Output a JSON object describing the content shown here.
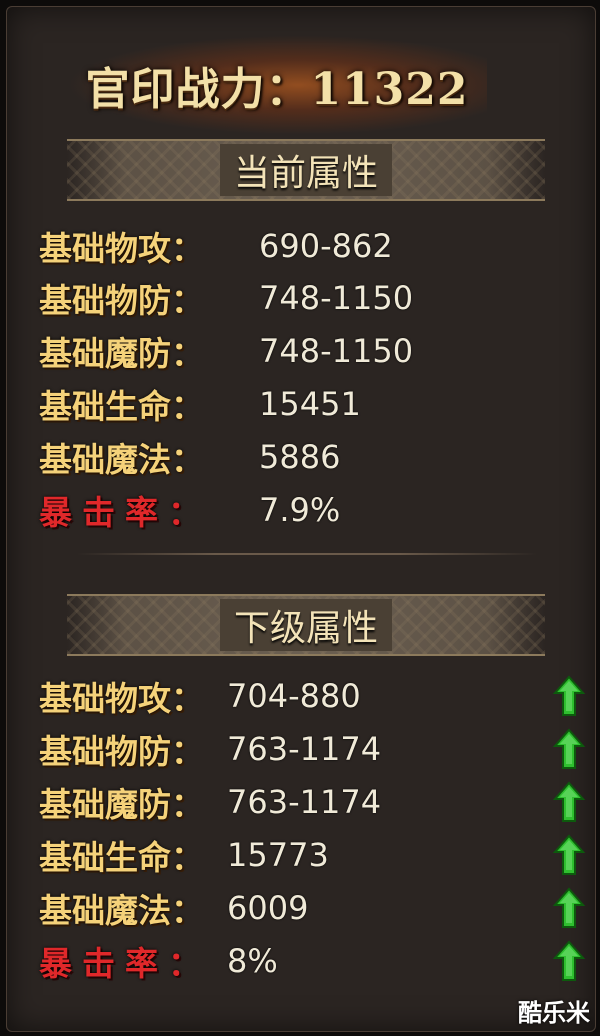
{
  "power": {
    "text": "官印战力：11322"
  },
  "current": {
    "title": "当前属性",
    "stats": [
      {
        "label": "基础物攻：",
        "value": "690-862"
      },
      {
        "label": "基础物防：",
        "value": "748-1150"
      },
      {
        "label": "基础魔防：",
        "value": "748-1150"
      },
      {
        "label": "基础生命：",
        "value": "15451"
      },
      {
        "label": "基础魔法：",
        "value": "5886"
      },
      {
        "label": "暴击率：",
        "value": "7.9%"
      }
    ]
  },
  "next": {
    "title": "下级属性",
    "stats": [
      {
        "label": "基础物攻：",
        "value": "704-880",
        "trend": "up-arrow-icon"
      },
      {
        "label": "基础物防：",
        "value": "763-1174",
        "trend": "up-arrow-icon"
      },
      {
        "label": "基础魔防：",
        "value": "763-1174",
        "trend": "up-arrow-icon"
      },
      {
        "label": "基础生命：",
        "value": "15773",
        "trend": "up-arrow-icon"
      },
      {
        "label": "基础魔法：",
        "value": "6009",
        "trend": "up-arrow-icon"
      },
      {
        "label": "暴击率：",
        "value": "8%",
        "trend": "up-arrow-icon"
      }
    ]
  },
  "colors": {
    "label": "#f5d27a",
    "crit": "#e0282a",
    "value": "#f0ead8",
    "arrow": "#2fbf2f"
  },
  "watermark": "酷乐米"
}
